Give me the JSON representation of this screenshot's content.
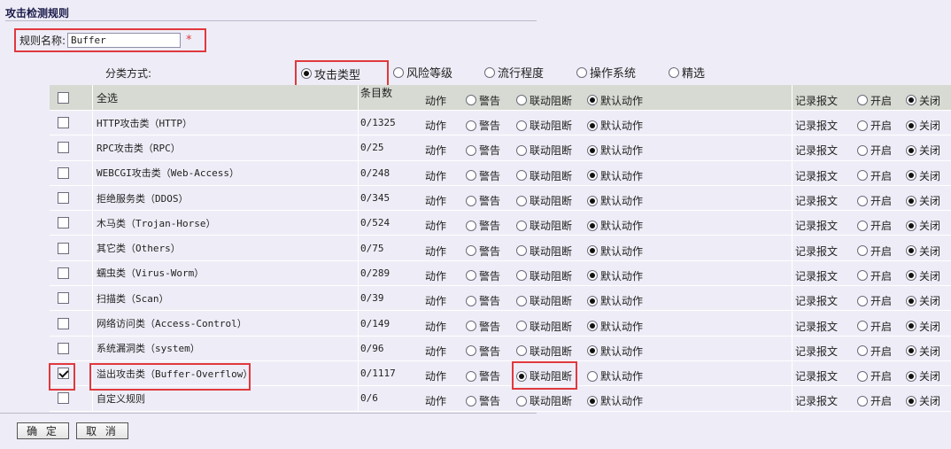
{
  "page_title": "攻击检测规则",
  "rule_name": {
    "label": "规则名称:",
    "value": "Buffer",
    "required_mark": "*"
  },
  "classify": {
    "label": "分类方式:",
    "options": [
      {
        "label": "攻击类型",
        "selected": true
      },
      {
        "label": "风险等级",
        "selected": false
      },
      {
        "label": "流行程度",
        "selected": false
      },
      {
        "label": "操作系统",
        "selected": false
      },
      {
        "label": "精选",
        "selected": false
      }
    ]
  },
  "table": {
    "header": {
      "select_all": "全选",
      "count": "条目数",
      "action": "动作",
      "warn": "警告",
      "block": "联动阻断",
      "default": "默认动作",
      "record": "记录报文",
      "on": "开启",
      "off": "关闭"
    },
    "labels": {
      "action": "动作",
      "warn": "警告",
      "block": "联动阻断",
      "default": "默认动作",
      "record": "记录报文",
      "on": "开启",
      "off": "关闭"
    },
    "rows": [
      {
        "name": "HTTP攻击类（HTTP）",
        "count": "0/1325",
        "checked": false,
        "action": "default",
        "record": "off"
      },
      {
        "name": "RPC攻击类（RPC）",
        "count": "0/25",
        "checked": false,
        "action": "default",
        "record": "off"
      },
      {
        "name": "WEBCGI攻击类（Web-Access）",
        "count": "0/248",
        "checked": false,
        "action": "default",
        "record": "off"
      },
      {
        "name": "拒绝服务类（DDOS）",
        "count": "0/345",
        "checked": false,
        "action": "default",
        "record": "off"
      },
      {
        "name": "木马类（Trojan-Horse）",
        "count": "0/524",
        "checked": false,
        "action": "default",
        "record": "off"
      },
      {
        "name": "其它类（Others）",
        "count": "0/75",
        "checked": false,
        "action": "default",
        "record": "off"
      },
      {
        "name": "蠕虫类（Virus-Worm）",
        "count": "0/289",
        "checked": false,
        "action": "default",
        "record": "off"
      },
      {
        "name": "扫描类（Scan）",
        "count": "0/39",
        "checked": false,
        "action": "default",
        "record": "off"
      },
      {
        "name": "网络访问类（Access-Control）",
        "count": "0/149",
        "checked": false,
        "action": "default",
        "record": "off"
      },
      {
        "name": "系统漏洞类（system）",
        "count": "0/96",
        "checked": false,
        "action": "default",
        "record": "off"
      },
      {
        "name": "溢出攻击类（Buffer-Overflow）",
        "count": "0/1117",
        "checked": true,
        "action": "block",
        "record": "off"
      },
      {
        "name": "自定义规则",
        "count": "0/6",
        "checked": false,
        "action": "default",
        "record": "off"
      }
    ]
  },
  "buttons": {
    "confirm": "确 定",
    "cancel": "取 消"
  },
  "colors": {
    "highlight": "#e0393e",
    "header_bg": "#d6dad2",
    "page_bg": "#eeedf7"
  }
}
